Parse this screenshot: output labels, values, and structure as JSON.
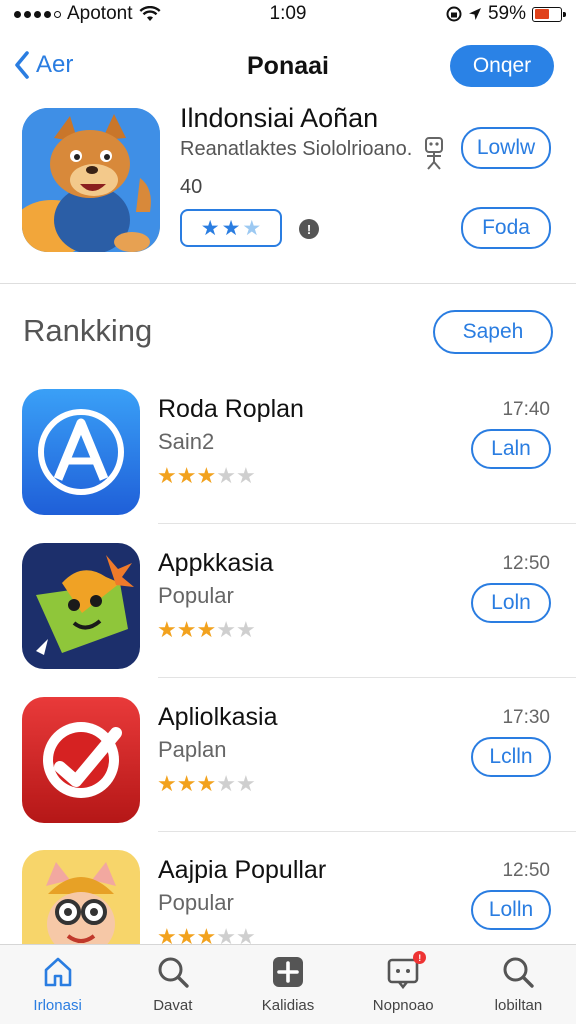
{
  "status_bar": {
    "carrier": "Apotont",
    "time": "1:09",
    "battery": "59%",
    "battery_level": 0.59
  },
  "nav": {
    "back_label": "Aer",
    "title": "Ponaai",
    "action_label": "Onqer"
  },
  "featured": {
    "title": "Ilndonsiai Aoñan",
    "subtitle": "Reanatlaktes Siololrioano.",
    "count": "40",
    "rating_stars": 3,
    "info_icon": "info-icon",
    "btn_low": "Lowlw",
    "btn_foda": "Foda"
  },
  "ranking": {
    "title": "Rankking",
    "action_label": "Sapeh",
    "items": [
      {
        "name": "Roda Roplan",
        "subtitle": "Sain2",
        "time": "17:40",
        "button": "Laln",
        "rating": 3,
        "icon": "app-store-icon"
      },
      {
        "name": "Appkkasia",
        "subtitle": "Popular",
        "time": "12:50",
        "button": "Loln",
        "rating": 3,
        "icon": "game-character-icon"
      },
      {
        "name": "Apliolkasia",
        "subtitle": "Paplan",
        "time": "17:30",
        "button": "Lclln",
        "rating": 3,
        "icon": "check-circle-icon"
      },
      {
        "name": "Aajpia Popullar",
        "subtitle": "Popular",
        "time": "12:50",
        "button": "Lolln",
        "rating": 3,
        "icon": "cat-avatar-icon"
      }
    ]
  },
  "tab_bar": {
    "items": [
      {
        "label": "Irlonasi",
        "icon": "home-icon",
        "active": true
      },
      {
        "label": "Davat",
        "icon": "search-icon",
        "active": false
      },
      {
        "label": "Kalidias",
        "icon": "plus-square-icon",
        "active": false
      },
      {
        "label": "Nopnoao",
        "icon": "notification-icon",
        "active": false
      },
      {
        "label": "lobiltan",
        "icon": "search-icon",
        "active": false
      }
    ]
  },
  "colors": {
    "accent": "#2a7de1",
    "star": "#f2a21e",
    "star_off": "#cfcfcf",
    "battery_low": "#e0421b"
  }
}
